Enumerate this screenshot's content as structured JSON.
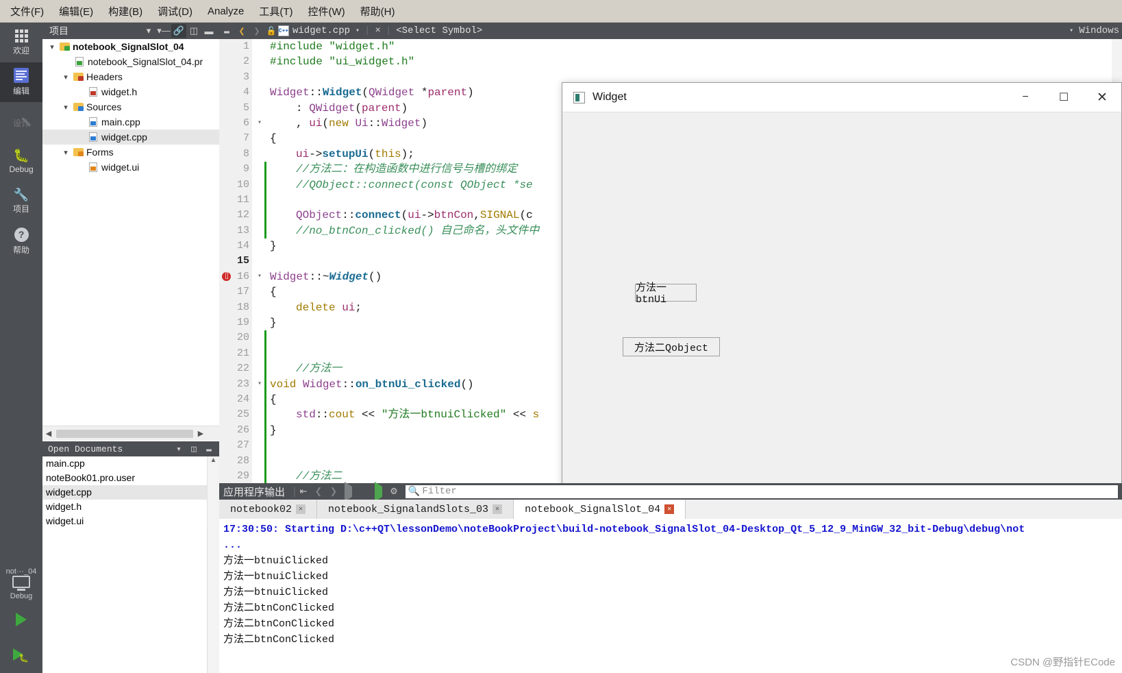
{
  "menubar": [
    {
      "label": "文件(F)",
      "key": "F"
    },
    {
      "label": "编辑(E)",
      "key": "E"
    },
    {
      "label": "构建(B)",
      "key": "B"
    },
    {
      "label": "调试(D)",
      "key": "D"
    },
    {
      "label": "Analyze",
      "key": "A"
    },
    {
      "label": "工具(T)",
      "key": "T"
    },
    {
      "label": "控件(W)",
      "key": "W"
    },
    {
      "label": "帮助(H)",
      "key": "H"
    }
  ],
  "activitybar": {
    "items": [
      {
        "label": "欢迎",
        "icon": "grid-icon",
        "state": "normal"
      },
      {
        "label": "编辑",
        "icon": "edit-document-icon",
        "state": "active"
      },
      {
        "label": "设计",
        "icon": "pencil-icon",
        "state": "disabled"
      },
      {
        "label": "Debug",
        "icon": "bug-icon",
        "state": "normal"
      },
      {
        "label": "项目",
        "icon": "wrench-icon",
        "state": "normal"
      },
      {
        "label": "帮助",
        "icon": "question-circle-icon",
        "state": "normal"
      }
    ],
    "kit": {
      "line1": "not···_04",
      "line2": "Debug"
    },
    "run_label": "run-icon",
    "debug_label": "debug-run-icon"
  },
  "project_panel": {
    "title": "项目",
    "toolbar_icons": [
      "chevron-down-icon",
      "filter-icon",
      "link-icon",
      "split-icon",
      "minimize-icon"
    ],
    "tree": [
      {
        "label": "notebook_SignalSlot_04",
        "depth": 0,
        "arrow": "v",
        "icon": "qt-project-folder-icon",
        "bold": true,
        "selected": false
      },
      {
        "label": "notebook_SignalSlot_04.pr",
        "depth": 1,
        "arrow": "",
        "icon": "pro-file-icon",
        "bold": false,
        "selected": false
      },
      {
        "label": "Headers",
        "depth": 1,
        "arrow": "v",
        "icon": "headers-folder-icon",
        "bold": false,
        "selected": false
      },
      {
        "label": "widget.h",
        "depth": 2,
        "arrow": "",
        "icon": "header-file-icon",
        "bold": false,
        "selected": false
      },
      {
        "label": "Sources",
        "depth": 1,
        "arrow": "v",
        "icon": "sources-folder-icon",
        "bold": false,
        "selected": false
      },
      {
        "label": "main.cpp",
        "depth": 2,
        "arrow": "",
        "icon": "cpp-file-icon",
        "bold": false,
        "selected": false
      },
      {
        "label": "widget.cpp",
        "depth": 2,
        "arrow": "",
        "icon": "cpp-file-icon",
        "bold": false,
        "selected": true
      },
      {
        "label": "Forms",
        "depth": 1,
        "arrow": "v",
        "icon": "forms-folder-icon",
        "bold": false,
        "selected": false
      },
      {
        "label": "widget.ui",
        "depth": 2,
        "arrow": "",
        "icon": "ui-file-icon",
        "bold": false,
        "selected": false
      }
    ]
  },
  "open_documents": {
    "title": "Open Documents",
    "items": [
      {
        "label": "main.cpp",
        "selected": false
      },
      {
        "label": "noteBook01.pro.user",
        "selected": false
      },
      {
        "label": "widget.cpp",
        "selected": true
      },
      {
        "label": "widget.h",
        "selected": false
      },
      {
        "label": "widget.ui",
        "selected": false
      }
    ]
  },
  "editor_tabbar": {
    "filename": "widget.cpp",
    "symbol_selector": "<Select Symbol>",
    "right_label": "Windows",
    "close_label": "×",
    "caret": "▾"
  },
  "code": {
    "lines": [
      {
        "n": 1,
        "fold": "",
        "indent": 0,
        "tokens": [
          [
            "k-pre",
            "#include"
          ],
          [
            "k-plain",
            " "
          ],
          [
            "k-str",
            "\"widget.h\""
          ]
        ]
      },
      {
        "n": 2,
        "fold": "",
        "indent": 0,
        "tokens": [
          [
            "k-pre",
            "#include"
          ],
          [
            "k-plain",
            " "
          ],
          [
            "k-str",
            "\"ui_widget.h\""
          ]
        ]
      },
      {
        "n": 3,
        "fold": "",
        "indent": 0,
        "tokens": []
      },
      {
        "n": 4,
        "fold": "",
        "indent": 0,
        "tokens": [
          [
            "k-cls",
            "Widget"
          ],
          [
            "k-plain",
            "::"
          ],
          [
            "k-fn",
            "Widget"
          ],
          [
            "k-plain",
            "("
          ],
          [
            "k-cls",
            "QWidget"
          ],
          [
            "k-plain",
            " *"
          ],
          [
            "k-fld",
            "parent"
          ],
          [
            "k-plain",
            ")"
          ]
        ]
      },
      {
        "n": 5,
        "fold": "",
        "indent": 1,
        "tokens": [
          [
            "k-plain",
            ": "
          ],
          [
            "k-cls",
            "QWidget"
          ],
          [
            "k-plain",
            "("
          ],
          [
            "k-fld",
            "parent"
          ],
          [
            "k-plain",
            ")"
          ]
        ]
      },
      {
        "n": 6,
        "fold": "▾",
        "indent": 1,
        "tokens": [
          [
            "k-plain",
            ", "
          ],
          [
            "k-fld",
            "ui"
          ],
          [
            "k-plain",
            "("
          ],
          [
            "k-kw",
            "new"
          ],
          [
            "k-plain",
            " "
          ],
          [
            "k-cls",
            "Ui"
          ],
          [
            "k-plain",
            "::"
          ],
          [
            "k-cls",
            "Widget"
          ],
          [
            "k-plain",
            ")"
          ]
        ]
      },
      {
        "n": 7,
        "fold": "",
        "indent": 0,
        "tokens": [
          [
            "k-plain",
            "{"
          ]
        ]
      },
      {
        "n": 8,
        "fold": "",
        "indent": 1,
        "tokens": [
          [
            "k-fld",
            "ui"
          ],
          [
            "k-plain",
            "->"
          ],
          [
            "k-fn",
            "setupUi"
          ],
          [
            "k-plain",
            "("
          ],
          [
            "k-kw",
            "this"
          ],
          [
            "k-plain",
            ");"
          ]
        ]
      },
      {
        "n": 9,
        "fold": "",
        "indent": 1,
        "tokens": [
          [
            "k-cmt",
            "//方法二：在构造函数中进行信号与槽的绑定"
          ]
        ]
      },
      {
        "n": 10,
        "fold": "",
        "indent": 1,
        "tokens": [
          [
            "k-cmt",
            "//QObject::connect(const QObject *se"
          ]
        ]
      },
      {
        "n": 11,
        "fold": "",
        "indent": 1,
        "tokens": []
      },
      {
        "n": 12,
        "fold": "",
        "indent": 1,
        "tokens": [
          [
            "k-cls",
            "QObject"
          ],
          [
            "k-plain",
            "::"
          ],
          [
            "k-fn",
            "connect"
          ],
          [
            "k-plain",
            "("
          ],
          [
            "k-fld",
            "ui"
          ],
          [
            "k-plain",
            "->"
          ],
          [
            "k-fld",
            "btnCon"
          ],
          [
            "k-plain",
            ","
          ],
          [
            "k-mac",
            "SIGNAL"
          ],
          [
            "k-plain",
            "(c"
          ]
        ]
      },
      {
        "n": 13,
        "fold": "",
        "indent": 1,
        "tokens": [
          [
            "k-cmt",
            "//no_btnCon_clicked() 自己命名，头文件中"
          ]
        ]
      },
      {
        "n": 14,
        "fold": "",
        "indent": 0,
        "tokens": [
          [
            "k-plain",
            "}"
          ]
        ]
      },
      {
        "n": 15,
        "fold": "",
        "indent": 0,
        "tokens": [],
        "current": true
      },
      {
        "n": 16,
        "fold": "▾",
        "indent": 0,
        "tokens": [
          [
            "k-cls",
            "Widget"
          ],
          [
            "k-plain",
            "::~"
          ],
          [
            "k-fni",
            "Widget"
          ],
          [
            "k-plain",
            "()"
          ]
        ],
        "breakpoint": true
      },
      {
        "n": 17,
        "fold": "",
        "indent": 0,
        "tokens": [
          [
            "k-plain",
            "{"
          ]
        ]
      },
      {
        "n": 18,
        "fold": "",
        "indent": 1,
        "tokens": [
          [
            "k-kw",
            "delete"
          ],
          [
            "k-plain",
            " "
          ],
          [
            "k-fld",
            "ui"
          ],
          [
            "k-plain",
            ";"
          ]
        ]
      },
      {
        "n": 19,
        "fold": "",
        "indent": 0,
        "tokens": [
          [
            "k-plain",
            "}"
          ]
        ]
      },
      {
        "n": 20,
        "fold": "",
        "indent": 0,
        "tokens": []
      },
      {
        "n": 21,
        "fold": "",
        "indent": 0,
        "tokens": []
      },
      {
        "n": 22,
        "fold": "",
        "indent": 1,
        "tokens": [
          [
            "k-cmt",
            "//方法一"
          ]
        ]
      },
      {
        "n": 23,
        "fold": "▾",
        "indent": 0,
        "tokens": [
          [
            "k-kw",
            "void"
          ],
          [
            "k-plain",
            " "
          ],
          [
            "k-cls",
            "Widget"
          ],
          [
            "k-plain",
            "::"
          ],
          [
            "k-fn",
            "on_btnUi_clicked"
          ],
          [
            "k-plain",
            "()"
          ]
        ]
      },
      {
        "n": 24,
        "fold": "",
        "indent": 0,
        "tokens": [
          [
            "k-plain",
            "{"
          ]
        ]
      },
      {
        "n": 25,
        "fold": "",
        "indent": 1,
        "tokens": [
          [
            "k-cls",
            "std"
          ],
          [
            "k-plain",
            "::"
          ],
          [
            "k-kw",
            "cout"
          ],
          [
            "k-plain",
            " << "
          ],
          [
            "k-str",
            "\"方法一btnuiClicked\""
          ],
          [
            "k-plain",
            " << "
          ],
          [
            "k-kw",
            "s"
          ]
        ]
      },
      {
        "n": 26,
        "fold": "",
        "indent": 0,
        "tokens": [
          [
            "k-plain",
            "}"
          ]
        ]
      },
      {
        "n": 27,
        "fold": "",
        "indent": 0,
        "tokens": []
      },
      {
        "n": 28,
        "fold": "",
        "indent": 0,
        "tokens": []
      },
      {
        "n": 29,
        "fold": "",
        "indent": 1,
        "tokens": [
          [
            "k-cmt",
            "//方法二"
          ]
        ]
      }
    ]
  },
  "qt_window": {
    "title": "Widget",
    "minimize": "−",
    "maximize": "☐",
    "close": "✕",
    "buttons": [
      {
        "label": "方法一btnUi"
      },
      {
        "label": "方法二Qobject"
      }
    ]
  },
  "output_pane": {
    "title": "应用程序输出",
    "toolbar": [
      "wrap-lines-icon",
      "prev-item-icon",
      "next-item-icon",
      "run-icon",
      "stop-icon",
      "debug-icon",
      "settings-icon"
    ],
    "filter_placeholder": "Filter",
    "tabs": [
      {
        "label": "notebook02",
        "active": false
      },
      {
        "label": "notebook_SignalandSlots_03",
        "active": false
      },
      {
        "label": "notebook_SignalSlot_04",
        "active": true
      }
    ],
    "console": [
      {
        "text": "17:30:50: Starting D:\\c++QT\\lessonDemo\\noteBookProject\\build-notebook_SignalSlot_04-Desktop_Qt_5_12_9_MinGW_32_bit-Debug\\debug\\not",
        "style": "start"
      },
      {
        "text": "...",
        "style": "dots"
      },
      {
        "text": "方法一btnuiClicked",
        "style": "plain"
      },
      {
        "text": "方法一btnuiClicked",
        "style": "plain"
      },
      {
        "text": "方法一btnuiClicked",
        "style": "plain"
      },
      {
        "text": "方法二btnConClicked",
        "style": "plain"
      },
      {
        "text": "方法二btnConClicked",
        "style": "plain"
      },
      {
        "text": "方法二btnConClicked",
        "style": "plain"
      }
    ]
  },
  "watermark": "CSDN @野指针ECode"
}
